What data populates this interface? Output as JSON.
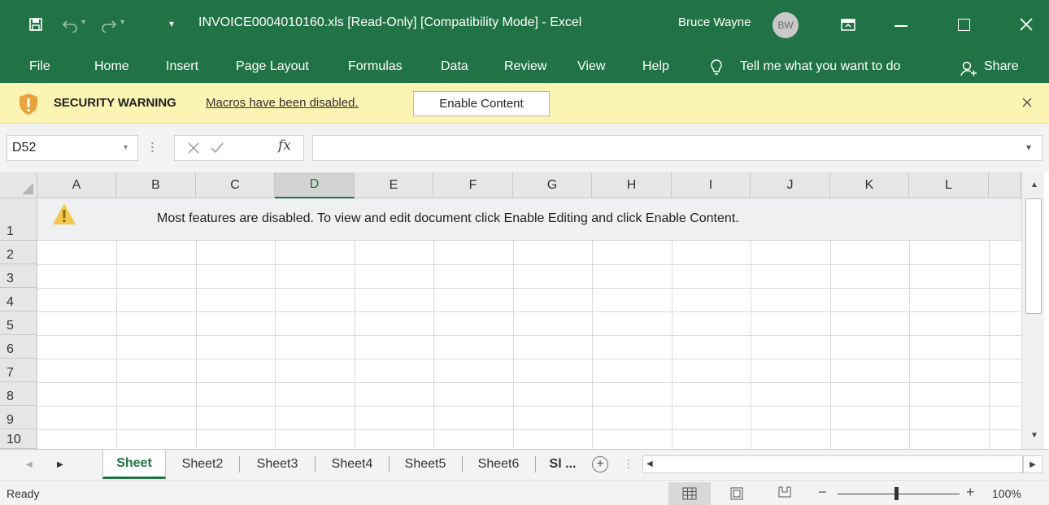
{
  "titlebar": {
    "title": "INVOICE0004010160.xls  [Read-Only]  [Compatibility Mode]  -  Excel",
    "user_name": "Bruce Wayne",
    "avatar_initials": "BW",
    "bg_color": "#217346"
  },
  "menubar": {
    "items": [
      "File",
      "Home",
      "Insert",
      "Page Layout",
      "Formulas",
      "Data",
      "Review",
      "View",
      "Help"
    ],
    "tell_me": "Tell me what you want to do",
    "share": "Share"
  },
  "security": {
    "title": "SECURITY WARNING",
    "message": "Macros have been disabled.",
    "button": "Enable Content",
    "bg_color": "#fcf4b2"
  },
  "formula": {
    "name_box": "D52",
    "fx": "fx",
    "value": ""
  },
  "grid": {
    "columns": [
      "A",
      "B",
      "C",
      "D",
      "E",
      "F",
      "G",
      "H",
      "I",
      "J",
      "K",
      "L"
    ],
    "active_column": "D",
    "rows": [
      "1",
      "2",
      "3",
      "4",
      "5",
      "6",
      "7",
      "8",
      "9",
      "10"
    ],
    "row1_message": "Most features are disabled. To view and edit document click Enable Editing and click Enable Content."
  },
  "sheets": {
    "tabs": [
      "Sheet",
      "Sheet2",
      "Sheet3",
      "Sheet4",
      "Sheet5",
      "Sheet6",
      "Sl ..."
    ],
    "active": "Sheet"
  },
  "status": {
    "text": "Ready",
    "zoom": "100%"
  }
}
